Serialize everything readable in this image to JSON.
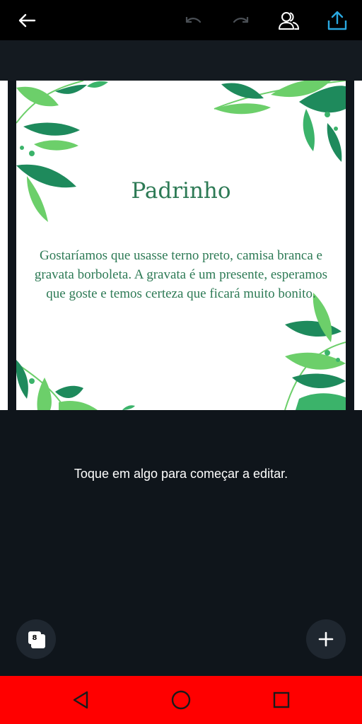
{
  "toolbar": {
    "back_icon": "arrow-left-icon",
    "undo_icon": "undo-icon",
    "redo_icon": "redo-icon",
    "collab_icon": "people-icon",
    "share_icon": "share-upload-icon",
    "share_color": "#2aa8e0"
  },
  "design": {
    "title": "Padrinho",
    "body": "Gostaríamos que usasse terno preto, camisa branca e gravata borboleta. A gravata é um presente, esperamos que goste e temos certeza que ficará muito bonito.",
    "text_color": "#2d7a55",
    "leaf_colors": [
      "#1e8a5c",
      "#6ccf6a",
      "#3bb36a"
    ]
  },
  "editor": {
    "hint": "Toque em algo para começar a editar.",
    "page_count": "8",
    "pages_icon": "pages-stack-icon",
    "add_icon": "plus-icon"
  },
  "system_nav": {
    "back_icon": "triangle-back-icon",
    "home_icon": "circle-home-icon",
    "recents_icon": "square-recents-icon",
    "bar_color": "#ff0000"
  }
}
